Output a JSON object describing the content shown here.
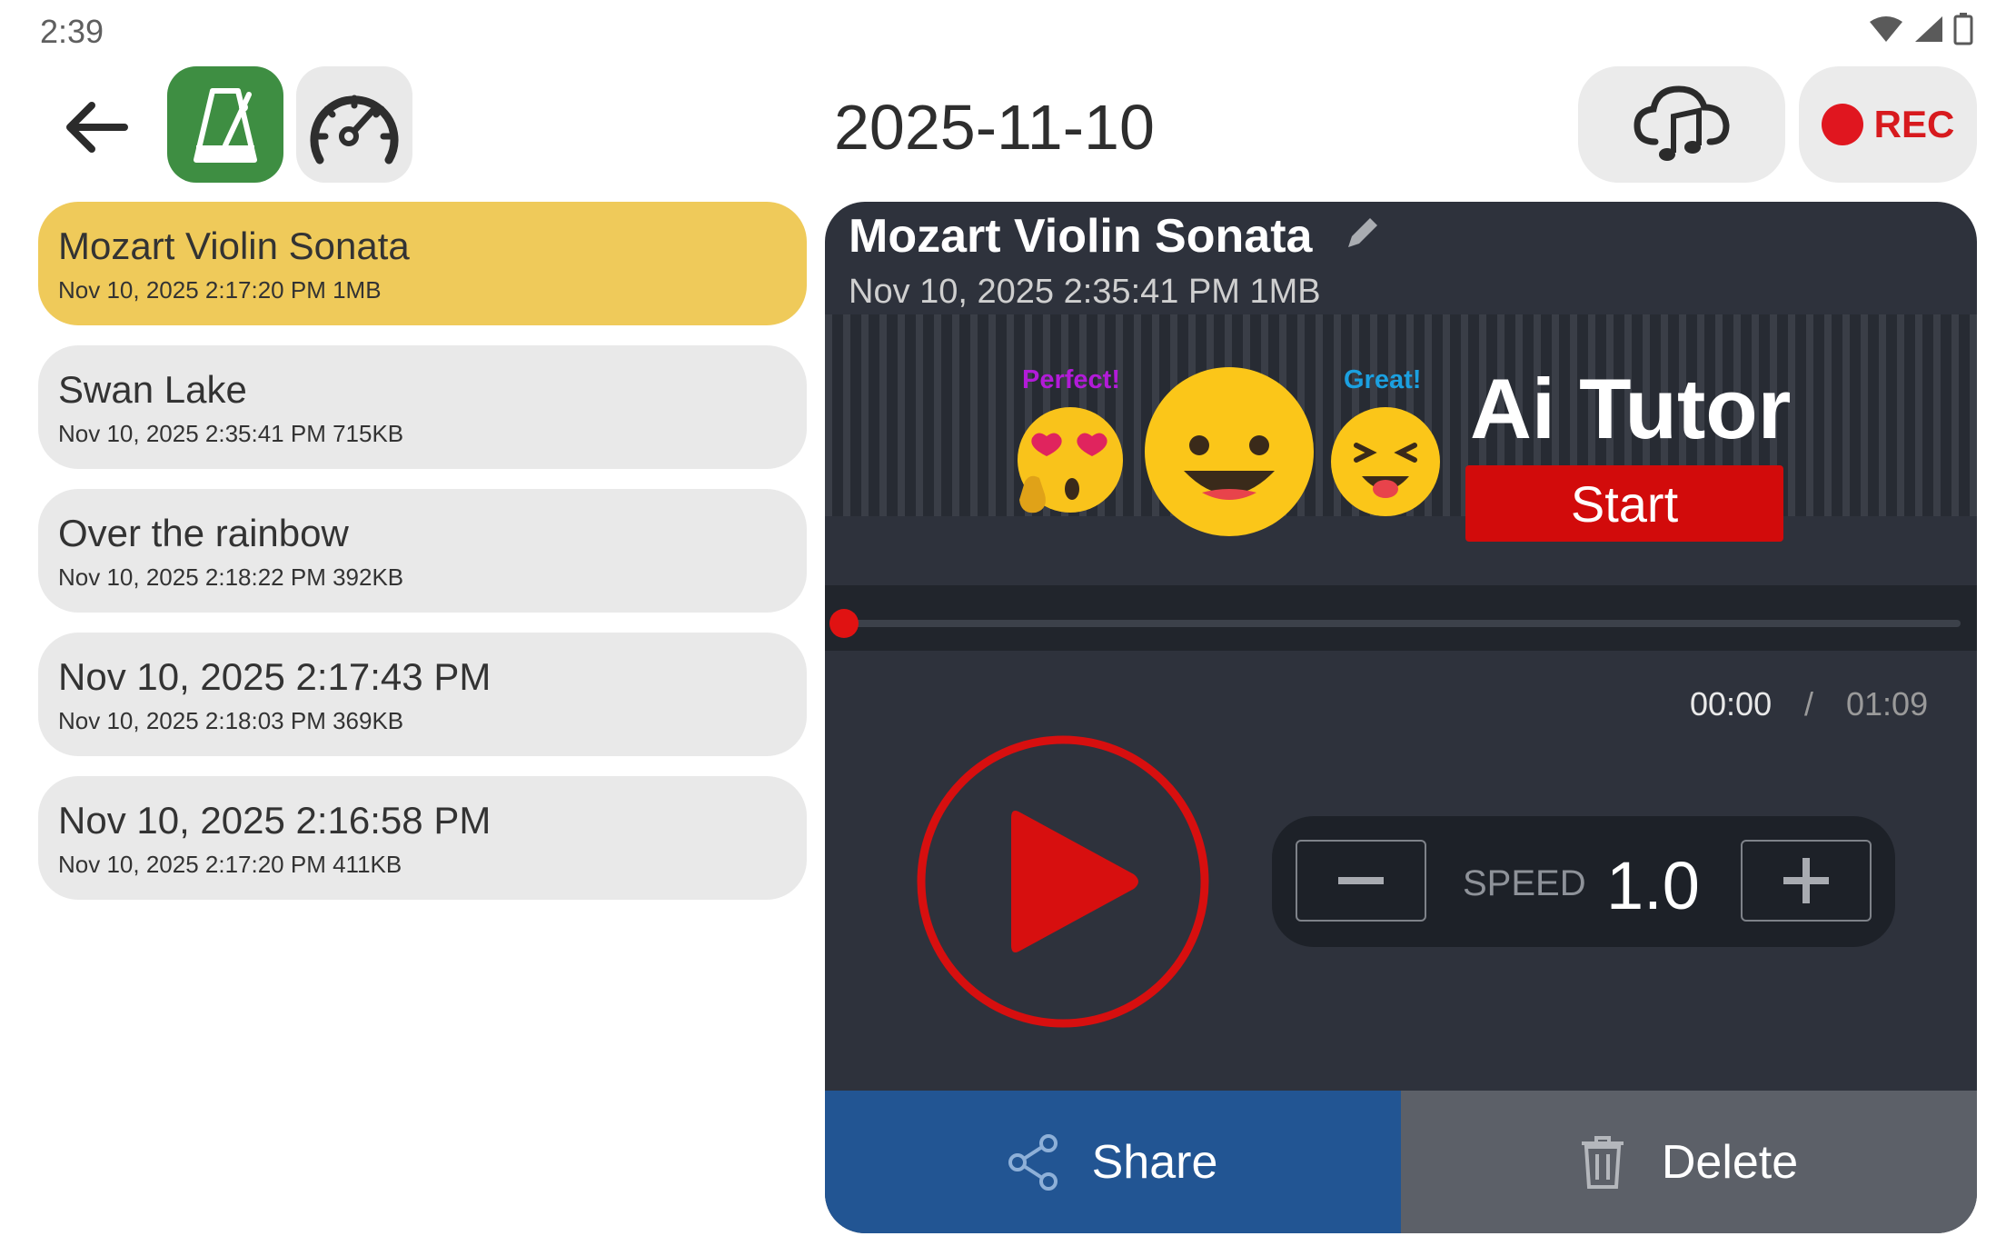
{
  "status_bar": {
    "time": "2:39"
  },
  "header": {
    "date_title": "2025-11-10",
    "rec_label": "REC"
  },
  "recordings": [
    {
      "title": "Mozart Violin Sonata",
      "meta": "Nov 10, 2025 2:17:20 PM 1MB",
      "selected": true
    },
    {
      "title": "Swan Lake",
      "meta": "Nov 10, 2025 2:35:41 PM 715KB"
    },
    {
      "title": "Over the rainbow",
      "meta": "Nov 10, 2025 2:18:22 PM 392KB"
    },
    {
      "title": "Nov 10, 2025 2:17:43 PM",
      "meta": "Nov 10, 2025 2:18:03 PM 369KB"
    },
    {
      "title": "Nov 10, 2025 2:16:58 PM",
      "meta": "Nov 10, 2025 2:17:20 PM 411KB"
    }
  ],
  "player": {
    "title": "Mozart Violin Sonata",
    "meta": "Nov 10, 2025 2:35:41 PM 1MB",
    "banner": {
      "perfect_label": "Perfect!",
      "great_label": "Great!",
      "brand": "Ai Tutor",
      "start_label": "Start"
    },
    "current_time": "00:00",
    "separator": "/",
    "total_time": "01:09",
    "speed_label": "SPEED",
    "speed_value": "1.0",
    "share_label": "Share",
    "delete_label": "Delete"
  },
  "colors": {
    "accent_selected": "#efca5a",
    "metronome_green": "#3e8e42",
    "rec_red": "#d71a1e",
    "share_blue": "#225593",
    "delete_gray": "#5c6068",
    "panel_dark": "#2e323c"
  }
}
